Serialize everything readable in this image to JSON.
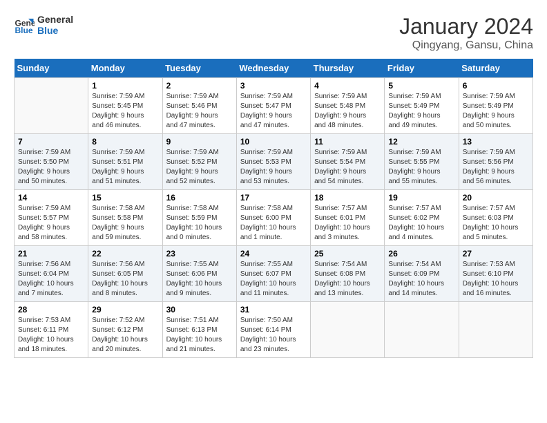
{
  "header": {
    "logo_line1": "General",
    "logo_line2": "Blue",
    "title": "January 2024",
    "subtitle": "Qingyang, Gansu, China"
  },
  "days_of_week": [
    "Sunday",
    "Monday",
    "Tuesday",
    "Wednesday",
    "Thursday",
    "Friday",
    "Saturday"
  ],
  "weeks": [
    [
      {
        "day": "",
        "info": ""
      },
      {
        "day": "1",
        "info": "Sunrise: 7:59 AM\nSunset: 5:45 PM\nDaylight: 9 hours\nand 46 minutes."
      },
      {
        "day": "2",
        "info": "Sunrise: 7:59 AM\nSunset: 5:46 PM\nDaylight: 9 hours\nand 47 minutes."
      },
      {
        "day": "3",
        "info": "Sunrise: 7:59 AM\nSunset: 5:47 PM\nDaylight: 9 hours\nand 47 minutes."
      },
      {
        "day": "4",
        "info": "Sunrise: 7:59 AM\nSunset: 5:48 PM\nDaylight: 9 hours\nand 48 minutes."
      },
      {
        "day": "5",
        "info": "Sunrise: 7:59 AM\nSunset: 5:49 PM\nDaylight: 9 hours\nand 49 minutes."
      },
      {
        "day": "6",
        "info": "Sunrise: 7:59 AM\nSunset: 5:49 PM\nDaylight: 9 hours\nand 50 minutes."
      }
    ],
    [
      {
        "day": "7",
        "info": "Sunrise: 7:59 AM\nSunset: 5:50 PM\nDaylight: 9 hours\nand 50 minutes."
      },
      {
        "day": "8",
        "info": "Sunrise: 7:59 AM\nSunset: 5:51 PM\nDaylight: 9 hours\nand 51 minutes."
      },
      {
        "day": "9",
        "info": "Sunrise: 7:59 AM\nSunset: 5:52 PM\nDaylight: 9 hours\nand 52 minutes."
      },
      {
        "day": "10",
        "info": "Sunrise: 7:59 AM\nSunset: 5:53 PM\nDaylight: 9 hours\nand 53 minutes."
      },
      {
        "day": "11",
        "info": "Sunrise: 7:59 AM\nSunset: 5:54 PM\nDaylight: 9 hours\nand 54 minutes."
      },
      {
        "day": "12",
        "info": "Sunrise: 7:59 AM\nSunset: 5:55 PM\nDaylight: 9 hours\nand 55 minutes."
      },
      {
        "day": "13",
        "info": "Sunrise: 7:59 AM\nSunset: 5:56 PM\nDaylight: 9 hours\nand 56 minutes."
      }
    ],
    [
      {
        "day": "14",
        "info": "Sunrise: 7:59 AM\nSunset: 5:57 PM\nDaylight: 9 hours\nand 58 minutes."
      },
      {
        "day": "15",
        "info": "Sunrise: 7:58 AM\nSunset: 5:58 PM\nDaylight: 9 hours\nand 59 minutes."
      },
      {
        "day": "16",
        "info": "Sunrise: 7:58 AM\nSunset: 5:59 PM\nDaylight: 10 hours\nand 0 minutes."
      },
      {
        "day": "17",
        "info": "Sunrise: 7:58 AM\nSunset: 6:00 PM\nDaylight: 10 hours\nand 1 minute."
      },
      {
        "day": "18",
        "info": "Sunrise: 7:57 AM\nSunset: 6:01 PM\nDaylight: 10 hours\nand 3 minutes."
      },
      {
        "day": "19",
        "info": "Sunrise: 7:57 AM\nSunset: 6:02 PM\nDaylight: 10 hours\nand 4 minutes."
      },
      {
        "day": "20",
        "info": "Sunrise: 7:57 AM\nSunset: 6:03 PM\nDaylight: 10 hours\nand 5 minutes."
      }
    ],
    [
      {
        "day": "21",
        "info": "Sunrise: 7:56 AM\nSunset: 6:04 PM\nDaylight: 10 hours\nand 7 minutes."
      },
      {
        "day": "22",
        "info": "Sunrise: 7:56 AM\nSunset: 6:05 PM\nDaylight: 10 hours\nand 8 minutes."
      },
      {
        "day": "23",
        "info": "Sunrise: 7:55 AM\nSunset: 6:06 PM\nDaylight: 10 hours\nand 9 minutes."
      },
      {
        "day": "24",
        "info": "Sunrise: 7:55 AM\nSunset: 6:07 PM\nDaylight: 10 hours\nand 11 minutes."
      },
      {
        "day": "25",
        "info": "Sunrise: 7:54 AM\nSunset: 6:08 PM\nDaylight: 10 hours\nand 13 minutes."
      },
      {
        "day": "26",
        "info": "Sunrise: 7:54 AM\nSunset: 6:09 PM\nDaylight: 10 hours\nand 14 minutes."
      },
      {
        "day": "27",
        "info": "Sunrise: 7:53 AM\nSunset: 6:10 PM\nDaylight: 10 hours\nand 16 minutes."
      }
    ],
    [
      {
        "day": "28",
        "info": "Sunrise: 7:53 AM\nSunset: 6:11 PM\nDaylight: 10 hours\nand 18 minutes."
      },
      {
        "day": "29",
        "info": "Sunrise: 7:52 AM\nSunset: 6:12 PM\nDaylight: 10 hours\nand 20 minutes."
      },
      {
        "day": "30",
        "info": "Sunrise: 7:51 AM\nSunset: 6:13 PM\nDaylight: 10 hours\nand 21 minutes."
      },
      {
        "day": "31",
        "info": "Sunrise: 7:50 AM\nSunset: 6:14 PM\nDaylight: 10 hours\nand 23 minutes."
      },
      {
        "day": "",
        "info": ""
      },
      {
        "day": "",
        "info": ""
      },
      {
        "day": "",
        "info": ""
      }
    ]
  ]
}
